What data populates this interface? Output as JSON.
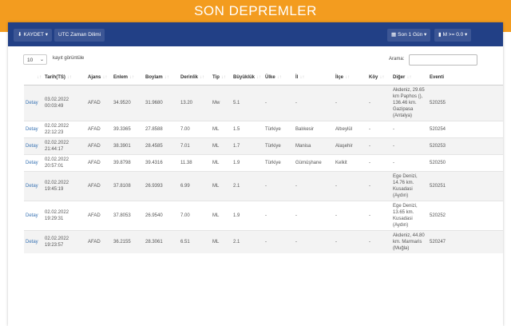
{
  "page": {
    "title": "SON DEPREMLER"
  },
  "toolbar": {
    "save_label": "KAYDET",
    "utc_label": "UTC Zaman Dilimi",
    "range_label": "Son 1 Gün",
    "magnitude_label": "M >= 0.0"
  },
  "controls": {
    "length_value": "10",
    "length_text": "kayıt görüntüle",
    "search_label": "Arama:",
    "search_value": ""
  },
  "table": {
    "headers": [
      "",
      "Tarih(TS)",
      "Ajans",
      "Enlem",
      "Boylam",
      "Derinlik",
      "Tip",
      "Büyüklük",
      "Ülke",
      "İl",
      "İlçe",
      "Köy",
      "Diğer",
      "Eventi"
    ],
    "rows": [
      [
        "Detay",
        "03.02.2022 00:03:49",
        "AFAD",
        "34.9520",
        "31.9680",
        "13.20",
        "Mw",
        "5.1",
        "-",
        "-",
        "-",
        "-",
        "Akdeniz, 29.65 km Paphos (), 136.46 km. Gazipasa (Antalya)",
        "520255"
      ],
      [
        "Detay",
        "02.02.2022 22:12:23",
        "AFAD",
        "39.3365",
        "27.8588",
        "7.00",
        "ML",
        "1.5",
        "Türkiye",
        "Balıkesir",
        "Altıeylül",
        "-",
        "-",
        "520254"
      ],
      [
        "Detay",
        "02.02.2022 21:44:17",
        "AFAD",
        "38.3901",
        "28.4585",
        "7.01",
        "ML",
        "1.7",
        "Türkiye",
        "Manisa",
        "Alaşehir",
        "-",
        "-",
        "520253"
      ],
      [
        "Detay",
        "02.02.2022 20:57:01",
        "AFAD",
        "39.8798",
        "39.4316",
        "11.38",
        "ML",
        "1.9",
        "Türkiye",
        "Gümüşhane",
        "Kelkit",
        "-",
        "-",
        "520250"
      ],
      [
        "Detay",
        "02.02.2022 19:45:19",
        "AFAD",
        "37.8108",
        "26.9393",
        "6.99",
        "ML",
        "2.1",
        "-",
        "-",
        "-",
        "-",
        "Ege Denizi, 14.76 km. Kusadasi (Aydın)",
        "520251"
      ],
      [
        "Detay",
        "02.02.2022 19:29:31",
        "AFAD",
        "37.8053",
        "26.9540",
        "7.00",
        "ML",
        "1.9",
        "-",
        "-",
        "-",
        "-",
        "Ege Denizi, 13.65 km. Kusadasi (Aydın)",
        "520252"
      ],
      [
        "Detay",
        "02.02.2022 19:23:57",
        "AFAD",
        "36.2155",
        "28.3061",
        "6.51",
        "ML",
        "2.1",
        "-",
        "-",
        "-",
        "-",
        "Akdeniz, 44.80 km. Marmaris (Muğla)",
        "520247"
      ]
    ]
  },
  "icons": {
    "save": "download-icon",
    "range": "calendar-icon",
    "magnitude": "bar-chart-icon",
    "sort": "sort-icon"
  },
  "colors": {
    "banner": "#f39c1f",
    "toolbar": "#224086",
    "link": "#3a74b4"
  }
}
